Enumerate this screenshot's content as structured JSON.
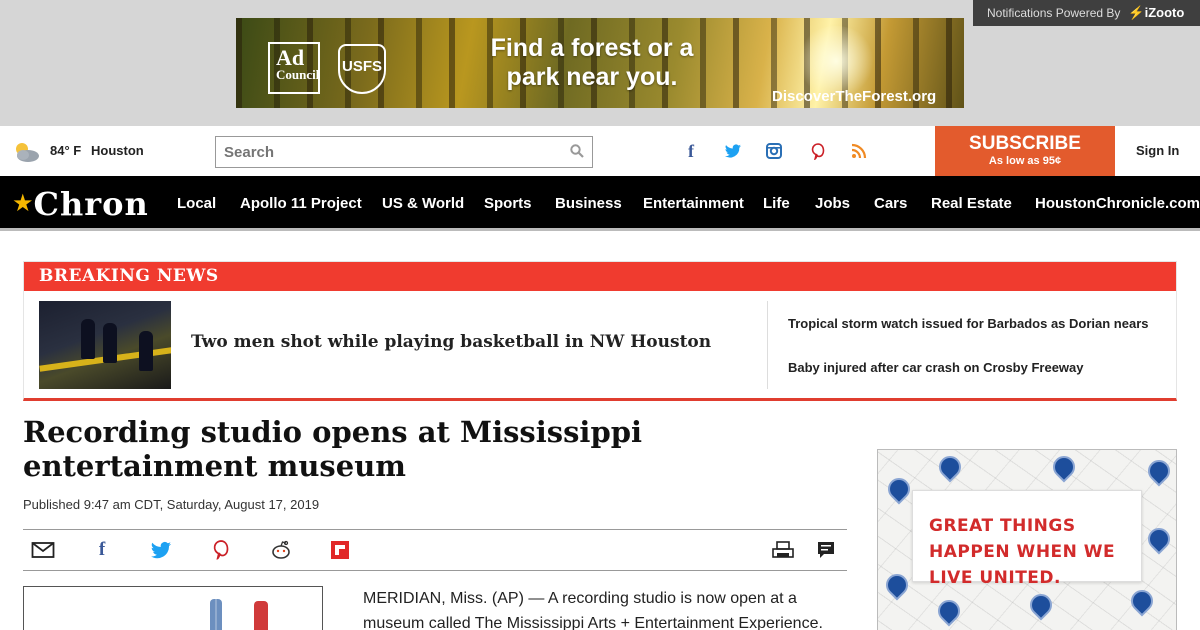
{
  "ad_banner": {
    "logo1": "Ad",
    "logo1_sub": "Council",
    "logo2": "USFS",
    "headline": "Find a forest or a park near you.",
    "url": "DiscoverTheForest.org"
  },
  "notifications": {
    "text": "Notifications Powered By",
    "brand": "iZooto"
  },
  "utility": {
    "temperature": "84° F",
    "city": "Houston",
    "search_placeholder": "Search",
    "subscribe_label": "SUBSCRIBE",
    "subscribe_sub": "As low as 95¢",
    "signin_label": "Sign In"
  },
  "social_icons": [
    "facebook-icon",
    "twitter-icon",
    "instagram-icon",
    "pinterest-icon",
    "rss-icon"
  ],
  "nav": {
    "logo": "Chron",
    "items": [
      "Local",
      "Apollo 11 Project",
      "US & World",
      "Sports",
      "Business",
      "Entertainment",
      "Life",
      "Jobs",
      "Cars",
      "Real Estate",
      "HoustonChronicle.com"
    ]
  },
  "breaking": {
    "title": "BREAKING NEWS",
    "main_story": "Two men shot while playing basketball in NW Houston",
    "side_stories": [
      "Tropical storm watch issued for Barbados as Dorian nears",
      "Baby injured after car crash on Crosby Freeway"
    ]
  },
  "article": {
    "headline": "Recording studio opens at Mississippi entertainment museum",
    "published": "Published 9:47 am CDT, Saturday, August 17, 2019",
    "body": "MERIDIAN, Miss. (AP) — A recording studio is now open at a museum called The Mississippi Arts + Entertainment Experience."
  },
  "share_icons": [
    "email-icon",
    "facebook-icon",
    "twitter-icon",
    "pinterest-icon",
    "reddit-icon",
    "flipboard-icon",
    "print-icon",
    "comments-icon"
  ],
  "side_ad": {
    "message": "GREAT THINGS HAPPEN WHEN WE LIVE UNITED."
  },
  "colors": {
    "breaking_red": "#f03b2f",
    "subscribe_orange": "#e35b2d",
    "nav_black": "#000000",
    "ad_red": "#d22b2b"
  }
}
